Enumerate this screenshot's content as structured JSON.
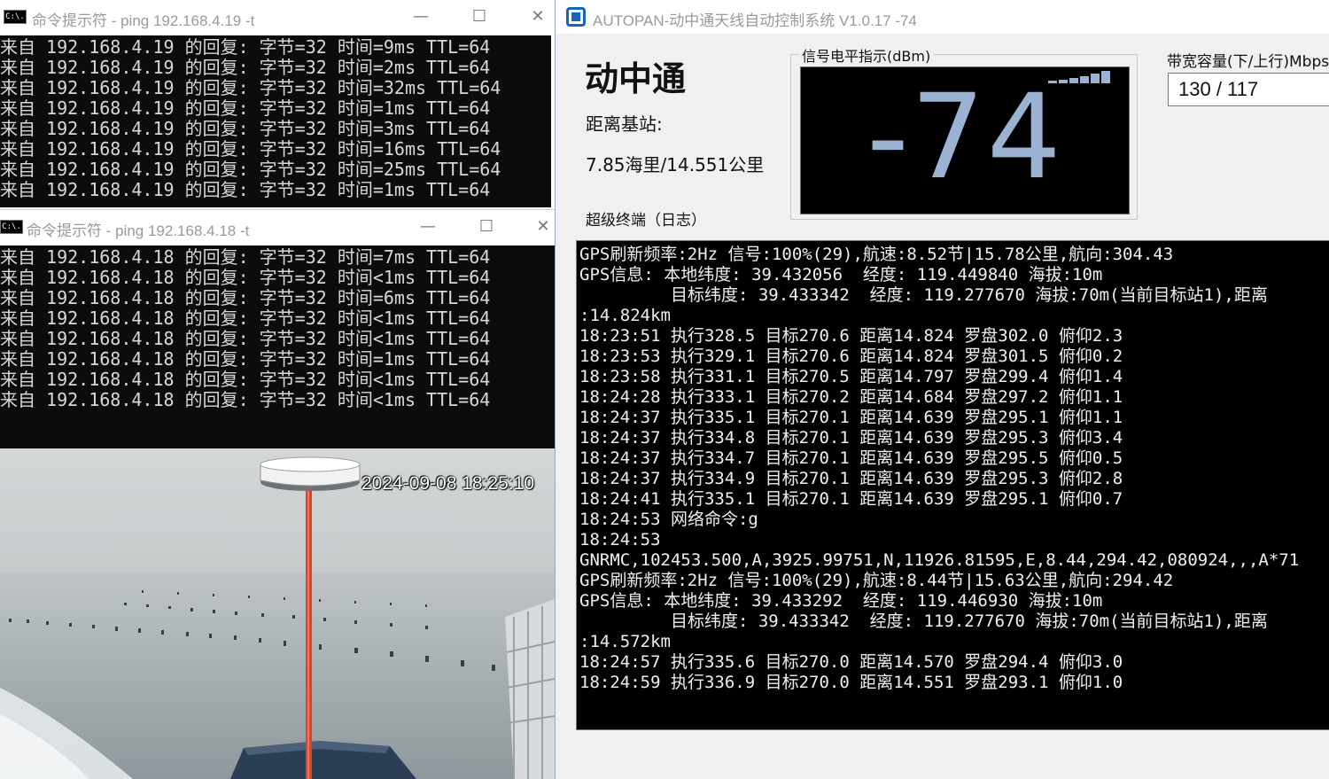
{
  "cmd_window_1": {
    "icon_text": "C:\\.",
    "title": "命令提示符 - ping  192.168.4.19 -t",
    "minimize": "—",
    "maximize": "☐",
    "close": "✕",
    "lines": [
      "来自 192.168.4.19 的回复: 字节=32 时间=9ms TTL=64",
      "来自 192.168.4.19 的回复: 字节=32 时间=2ms TTL=64",
      "来自 192.168.4.19 的回复: 字节=32 时间=32ms TTL=64",
      "来自 192.168.4.19 的回复: 字节=32 时间=1ms TTL=64",
      "来自 192.168.4.19 的回复: 字节=32 时间=3ms TTL=64",
      "来自 192.168.4.19 的回复: 字节=32 时间=16ms TTL=64",
      "来自 192.168.4.19 的回复: 字节=32 时间=25ms TTL=64",
      "来自 192.168.4.19 的回复: 字节=32 时间=1ms TTL=64"
    ]
  },
  "cmd_window_2": {
    "icon_text": "C:\\.",
    "title": "命令提示符 - ping  192.168.4.18 -t",
    "minimize": "—",
    "maximize": "☐",
    "close": "✕",
    "lines": [
      "来自 192.168.4.18 的回复: 字节=32 时间=7ms TTL=64",
      "来自 192.168.4.18 的回复: 字节=32 时间<1ms TTL=64",
      "来自 192.168.4.18 的回复: 字节=32 时间=6ms TTL=64",
      "来自 192.168.4.18 的回复: 字节=32 时间<1ms TTL=64",
      "来自 192.168.4.18 的回复: 字节=32 时间<1ms TTL=64",
      "来自 192.168.4.18 的回复: 字节=32 时间=1ms TTL=64",
      "来自 192.168.4.18 的回复: 字节=32 时间<1ms TTL=64",
      "来自 192.168.4.18 的回复: 字节=32 时间<1ms TTL=64"
    ]
  },
  "camera": {
    "timestamp": "2024-09-08 18:25:10"
  },
  "app": {
    "title": "AUTOPAN-动中通天线自动控制系统 V1.0.17 -74",
    "brand": "动中通",
    "distance_label": "距离基站:",
    "distance_value": "7.85海里/14.551公里",
    "log_label": "超级终端（日志）",
    "signal_label": "信号电平指示(dBm)",
    "signal_value": "-74",
    "bandwidth_label": "带宽容量(下/上行)Mbps",
    "bandwidth_value": "130 / 117",
    "accent_color": "#9cb2d2",
    "log_lines": [
      "GPS刷新频率:2Hz 信号:100%(29),航速:8.52节|15.78公里,航向:304.43",
      "GPS信息: 本地纬度: 39.432056  经度: 119.449840 海拔:10m",
      "         目标纬度: 39.433342  经度: 119.277670 海拔:70m(当前目标站1),距离",
      ":14.824km",
      "18:23:51 执行328.5 目标270.6 距离14.824 罗盘302.0 俯仰2.3",
      "18:23:53 执行329.1 目标270.6 距离14.824 罗盘301.5 俯仰0.2",
      "18:23:58 执行331.1 目标270.5 距离14.797 罗盘299.4 俯仰1.4",
      "18:24:28 执行333.1 目标270.2 距离14.684 罗盘297.2 俯仰1.1",
      "18:24:37 执行335.1 目标270.1 距离14.639 罗盘295.1 俯仰1.1",
      "18:24:37 执行334.8 目标270.1 距离14.639 罗盘295.3 俯仰3.4",
      "18:24:37 执行334.7 目标270.1 距离14.639 罗盘295.5 俯仰0.5",
      "18:24:37 执行334.9 目标270.1 距离14.639 罗盘295.3 俯仰2.8",
      "18:24:41 执行335.1 目标270.1 距离14.639 罗盘295.1 俯仰0.7",
      "18:24:53 网络命令:g",
      "18:24:53",
      "GNRMC,102453.500,A,3925.99751,N,11926.81595,E,8.44,294.42,080924,,,A*71",
      "GPS刷新频率:2Hz 信号:100%(29),航速:8.44节|15.63公里,航向:294.42",
      "GPS信息: 本地纬度: 39.433292  经度: 119.446930 海拔:10m",
      "         目标纬度: 39.433342  经度: 119.277670 海拔:70m(当前目标站1),距离",
      ":14.572km",
      "18:24:57 执行335.6 目标270.0 距离14.570 罗盘294.4 俯仰3.0",
      "18:24:59 执行336.9 目标270.0 距离14.551 罗盘293.1 俯仰1.0"
    ]
  }
}
